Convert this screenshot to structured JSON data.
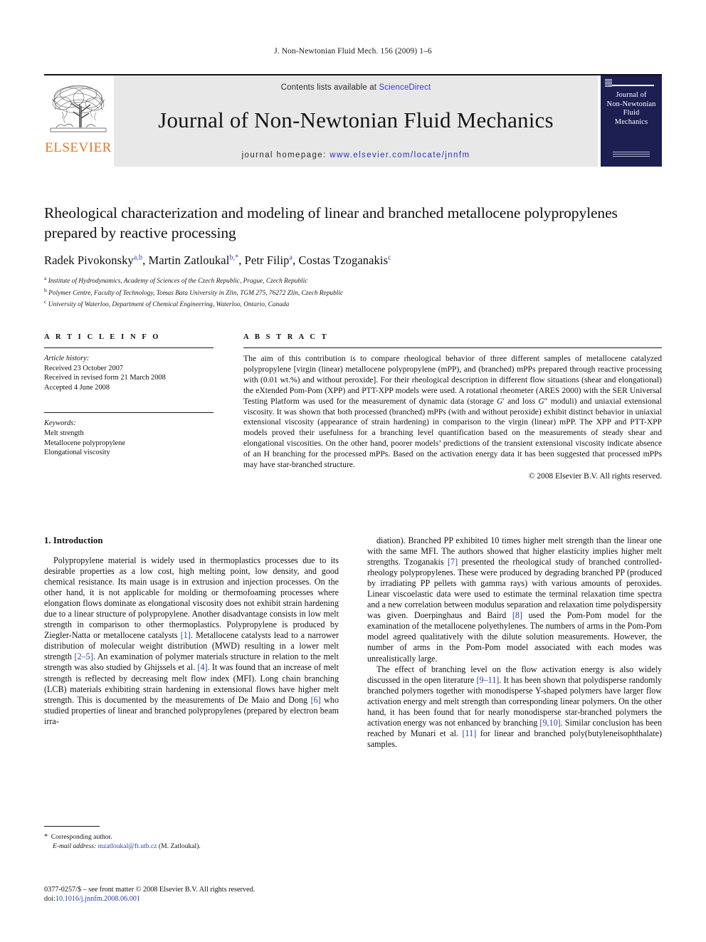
{
  "running_head": "J. Non-Newtonian Fluid Mech. 156 (2009) 1–6",
  "masthead": {
    "publisher_logo_label": "ELSEVIER",
    "contents_prefix": "Contents lists available at ",
    "contents_link": "ScienceDirect",
    "journal_title": "Journal of Non-Newtonian Fluid Mechanics",
    "homepage_prefix": "journal homepage: ",
    "homepage_url": "www.elsevier.com/locate/jnnfm",
    "cover_title_lines": [
      "Journal of",
      "Non-Newtonian",
      "Fluid",
      "Mechanics"
    ],
    "link_color": "#3a3ac4",
    "elsevier_orange": "#E87722",
    "cover_navy": "#1d1f52",
    "band_gray": "#e8e8e8"
  },
  "article": {
    "title": "Rheological characterization and modeling of linear and branched metallocene polypropylenes prepared by reactive processing",
    "authors_html": "Radek Pivokonsky<sup>a,b</sup>, Martin Zatloukal<sup>b,*</sup>, Petr Filip<sup>a</sup>, Costas Tzoganakis<sup>c</sup>",
    "affiliations": [
      {
        "marker": "a",
        "text": "Institute of Hydrodynamics, Academy of Sciences of the Czech Republic, Prague, Czech Republic"
      },
      {
        "marker": "b",
        "text": "Polymer Centre, Faculty of Technology, Tomas Bata University in Zlin, TGM 275, 76272 Zlin, Czech Republic"
      },
      {
        "marker": "c",
        "text": "University of Waterloo, Department of Chemical Engineering, Waterloo, Ontario, Canada"
      }
    ]
  },
  "article_info": {
    "heading": "A R T I C L E     I N F O",
    "history_label": "Article history:",
    "history": [
      "Received 23 October 2007",
      "Received in revised form 21 March 2008",
      "Accepted 4 June 2008"
    ],
    "keywords_label": "Keywords:",
    "keywords": [
      "Melt strength",
      "Metallocene polypropylene",
      "Elongational viscosity"
    ]
  },
  "abstract": {
    "heading": "A B S T R A C T",
    "text_html": "The aim of this contribution is to compare rheological behavior of three different samples of metallocene catalyzed polypropylene [virgin (linear) metallocene polypropylene (mPP), and (branched) mPPs prepared through reactive processing with (0.01 wt.%) and without peroxide]. For their rheological description in different flow situations (shear and elongational) the eXtended Pom-Pom (XPP) and PTT-XPP models were used. A rotational rheometer (ARES 2000) with the SER Universal Testing Platform was used for the measurement of dynamic data (storage <i>G</i>&#8242; and loss <i>G</i>&#8243; moduli) and uniaxial extensional viscosity. It was shown that both processed (branched) mPPs (with and without peroxide) exhibit distinct behavior in uniaxial extensional viscosity (appearance of strain hardening) in comparison to the virgin (linear) mPP. The XPP and PTT-XPP models proved their usefulness for a branching level quantification based on the measurements of steady shear and elongational viscosities. On the other hand, poorer models&#8217; predictions of the transient extensional viscosity indicate absence of an H branching for the processed mPPs. Based on the activation energy data it has been suggested that processed mPPs may have star-branched structure.",
    "copyright": "© 2008 Elsevier B.V. All rights reserved."
  },
  "body": {
    "section_number_title": "1.  Introduction",
    "left_paragraph_html": "Polypropylene material is widely used in thermoplastics processes due to its desirable properties as a low cost, high melting point, low density, and good chemical resistance. Its main usage is in extrusion and injection processes. On the other hand, it is not applicable for molding or thermofoaming processes where elongation flows dominate as elongational viscosity does not exhibit strain hardening due to a linear structure of polypropylene. Another disadvantage consists in low melt strength in comparison to other thermoplastics. Polypropylene is produced by Ziegler-Natta or metallocene catalysts <span class=\"ref\">[1]</span>. Metallocene catalysts lead to a narrower distribution of molecular weight distribution (MWD) resulting in a lower melt strength <span class=\"ref\">[2–5]</span>. An examination of polymer materials structure in relation to the melt strength was also studied by Ghijssels et al. <span class=\"ref\">[4]</span>. It was found that an increase of melt strength is reflected by decreasing melt flow index (MFI). Long chain branching (LCB) materials exhibiting strain hardening in extensional flows have higher melt strength. This is documented by the measurements of De Maio and Dong <span class=\"ref\">[6]</span> who studied properties of linear and branched polypropylenes (prepared by electron beam irra-",
    "right_paragraph_1_html": "diation). Branched PP exhibited 10 times higher melt strength than the linear one with the same MFI. The authors showed that higher elasticity implies higher melt strengths. Tzoganakis <span class=\"ref\">[7]</span> presented the rheological study of branched controlled-rheology polypropylenes. These were produced by degrading branched PP (produced by irradiating PP pellets with gamma rays) with various amounts of peroxides. Linear viscoelastic data were used to estimate the terminal relaxation time spectra and a new correlation between modulus separation and relaxation time polydispersity was given. Doerpinghaus and Baird <span class=\"ref\">[8]</span> used the Pom-Pom model for the examination of the metallocene polyethylenes. The numbers of arms in the Pom-Pom model agreed qualitatively with the dilute solution measurements. However, the number of arms in the Pom-Pom model associated with each modes was unrealistically large.",
    "right_paragraph_2_html": "The effect of branching level on the flow activation energy is also widely discussed in the open literature <span class=\"ref\">[9–11]</span>. It has been shown that polydisperse randomly branched polymers together with monodisperse Y-shaped polymers have larger flow activation energy and melt strength than corresponding linear polymers. On the other hand, it has been found that for nearly monodisperse star-branched polymers the activation energy was not enhanced by branching <span class=\"ref\">[9,10]</span>. Similar conclusion has been reached by Munari et al. <span class=\"ref\">[11]</span> for linear and branched poly(butyleneisophthalate) samples."
  },
  "footnote": {
    "corresponding": "Corresponding author.",
    "email_label": "E-mail address:",
    "email": "mzatloukal@ft.utb.cz",
    "email_suffix": "(M. Zatloukal)."
  },
  "imprint": {
    "line1": "0377-0257/$ – see front matter © 2008 Elsevier B.V. All rights reserved.",
    "doi_label": "doi:",
    "doi_value": "10.1016/j.jnnfm.2008.06.001"
  }
}
